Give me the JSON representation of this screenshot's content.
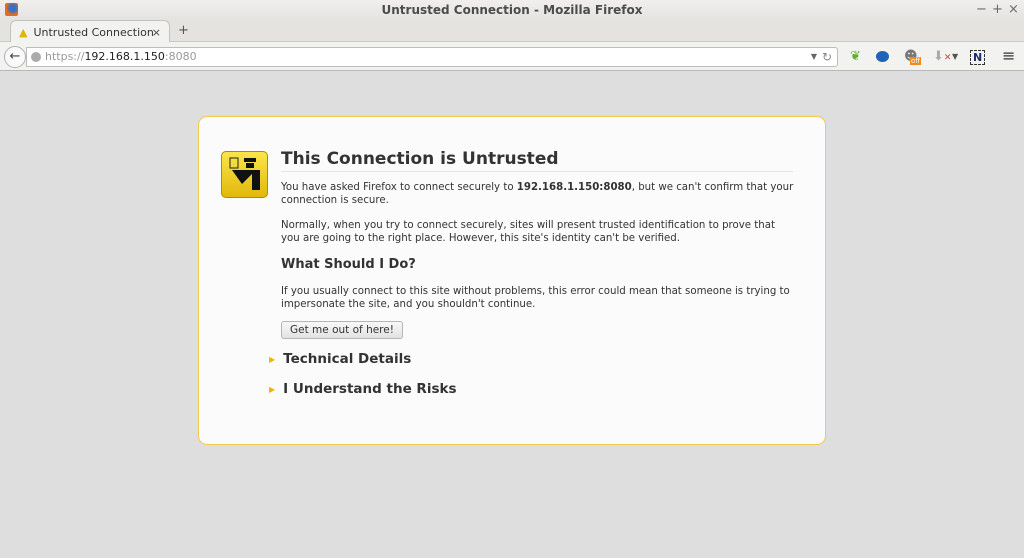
{
  "window": {
    "title": "Untrusted Connection - Mozilla Firefox",
    "min": "−",
    "max": "+",
    "close": "×"
  },
  "tab": {
    "label": "Untrusted Connection",
    "close": "×",
    "new": "+"
  },
  "nav": {
    "back": "←",
    "url_scheme": "https://",
    "url_host": "192.168.1.150",
    "url_port": ":8080",
    "dropdown": "▼",
    "reload": "↻",
    "toolbar_icons": [
      "leaf-icon",
      "blue-play-icon",
      "ghostery-off-icon",
      "download-blocked-icon",
      "dropdown-icon",
      "notes-n-icon",
      "menu-icon"
    ],
    "off_badge": "off",
    "n": "N",
    "menu": "≡"
  },
  "page": {
    "title": "This Connection is Untrusted",
    "p1_a": "You have asked Firefox to connect securely to ",
    "p1_host": "192.168.1.150:8080",
    "p1_b": ", but we can't confirm that your connection is secure.",
    "p2": "Normally, when you try to connect securely, sites will present trusted identification to prove that you are going to the right place. However, this site's identity can't be verified.",
    "h2": "What Should I Do?",
    "p3": "If you usually connect to this site without problems, this error could mean that someone is trying to impersonate the site, and you shouldn't continue.",
    "button": "Get me out of here!",
    "technical": "Technical Details",
    "risks": "I Understand the Risks"
  }
}
